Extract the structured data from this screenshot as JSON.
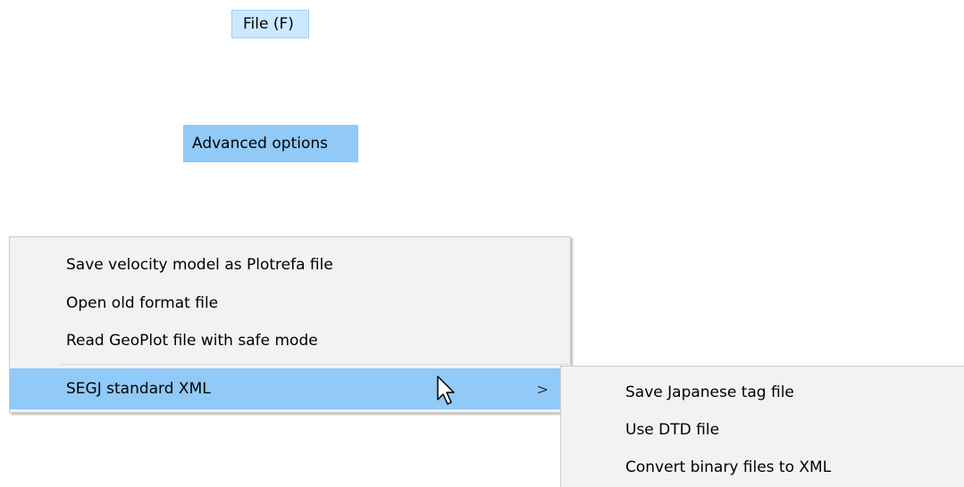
{
  "menubar": {
    "file_label": "File (F)"
  },
  "file_menu": {
    "advanced_label": "Advanced options"
  },
  "advanced_menu": {
    "items": [
      {
        "label": "Save velocity model as Plotrefa file"
      },
      {
        "label": "Open old format file"
      },
      {
        "label": "Read GeoPlot file with safe mode"
      },
      {
        "label": "SEGJ standard XML",
        "submenu_arrow": ">"
      }
    ]
  },
  "xml_submenu": {
    "items": [
      {
        "label": "Save Japanese tag file"
      },
      {
        "label": "Use DTD file"
      },
      {
        "label": "Convert binary files to XML"
      }
    ]
  },
  "colors": {
    "highlight": "#91c9f7",
    "menubar_highlight": "#cce8ff",
    "menu_bg": "#f2f2f2"
  },
  "icons": {
    "pointer": "mouse-pointer-icon",
    "submenu": "chevron-right-icon"
  }
}
